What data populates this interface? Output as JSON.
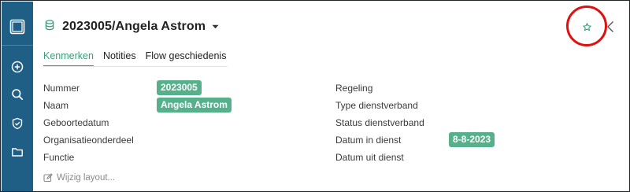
{
  "header": {
    "title": "2023005/Angela Astrom",
    "icons": {
      "record": "database-icon",
      "dropdown": "caret-down-icon",
      "favorite": "star-icon",
      "close": "close-icon"
    }
  },
  "sidebar": {
    "items": [
      {
        "icon": "panel-toggle-icon"
      },
      {
        "icon": "add-circle-icon"
      },
      {
        "icon": "search-icon"
      },
      {
        "icon": "shield-icon"
      },
      {
        "icon": "folder-icon"
      }
    ]
  },
  "tabs": [
    {
      "label": "Kenmerken",
      "active": true
    },
    {
      "label": "Notities",
      "active": false
    },
    {
      "label": "Flow geschiedenis",
      "active": false
    }
  ],
  "fields_left": [
    {
      "label": "Nummer",
      "value": "2023005"
    },
    {
      "label": "Naam",
      "value": "Angela Astrom"
    },
    {
      "label": "Geboortedatum",
      "value": ""
    },
    {
      "label": "Organisatieonderdeel",
      "value": ""
    },
    {
      "label": "Functie",
      "value": ""
    }
  ],
  "fields_right": [
    {
      "label": "Regeling",
      "value": ""
    },
    {
      "label": "Type dienstverband",
      "value": ""
    },
    {
      "label": "Status dienstverband",
      "value": ""
    },
    {
      "label": "Datum in dienst",
      "value": "8-8-2023"
    },
    {
      "label": "Datum uit dienst",
      "value": ""
    }
  ],
  "footer": {
    "edit_layout_label": "Wijzig layout..."
  },
  "colors": {
    "sidebar": "#1f5f86",
    "accent": "#3a9e78",
    "badge": "#56b08c",
    "highlight": "#e01010"
  }
}
